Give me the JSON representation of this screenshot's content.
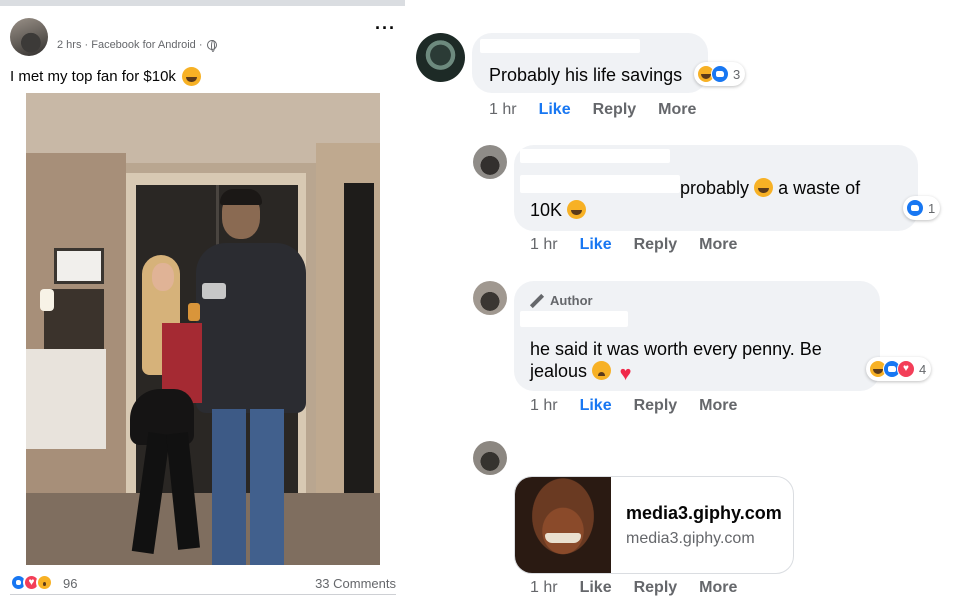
{
  "post": {
    "meta": "2 hrs · Facebook for Android ·",
    "text": "I met my top fan for $10k",
    "reaction_count": "96",
    "comments": "33 Comments",
    "menu": "···"
  },
  "comments": [
    {
      "text": "Probably his life savings",
      "reactions": "3",
      "time": "1 hr",
      "like": "Like",
      "reply": "Reply",
      "more": "More"
    },
    {
      "text_part1": "probably",
      "text_part2": "a waste of",
      "text_line2": "10K",
      "reactions": "1",
      "time": "1 hr",
      "like": "Like",
      "reply": "Reply",
      "more": "More"
    },
    {
      "author_badge": "Author",
      "text_line1": "he said it was worth every penny. Be",
      "text_line2": "jealous",
      "reactions": "4",
      "time": "1 hr",
      "like": "Like",
      "reply": "Reply",
      "more": "More"
    },
    {
      "link_title": "media3.giphy.com",
      "link_sub": "media3.giphy.com",
      "time": "1 hr",
      "like": "Like",
      "reply": "Reply",
      "more": "More"
    }
  ],
  "colors": {
    "accent": "#1877f2",
    "bubble": "#f0f2f5",
    "secondary_text": "#65676b"
  }
}
